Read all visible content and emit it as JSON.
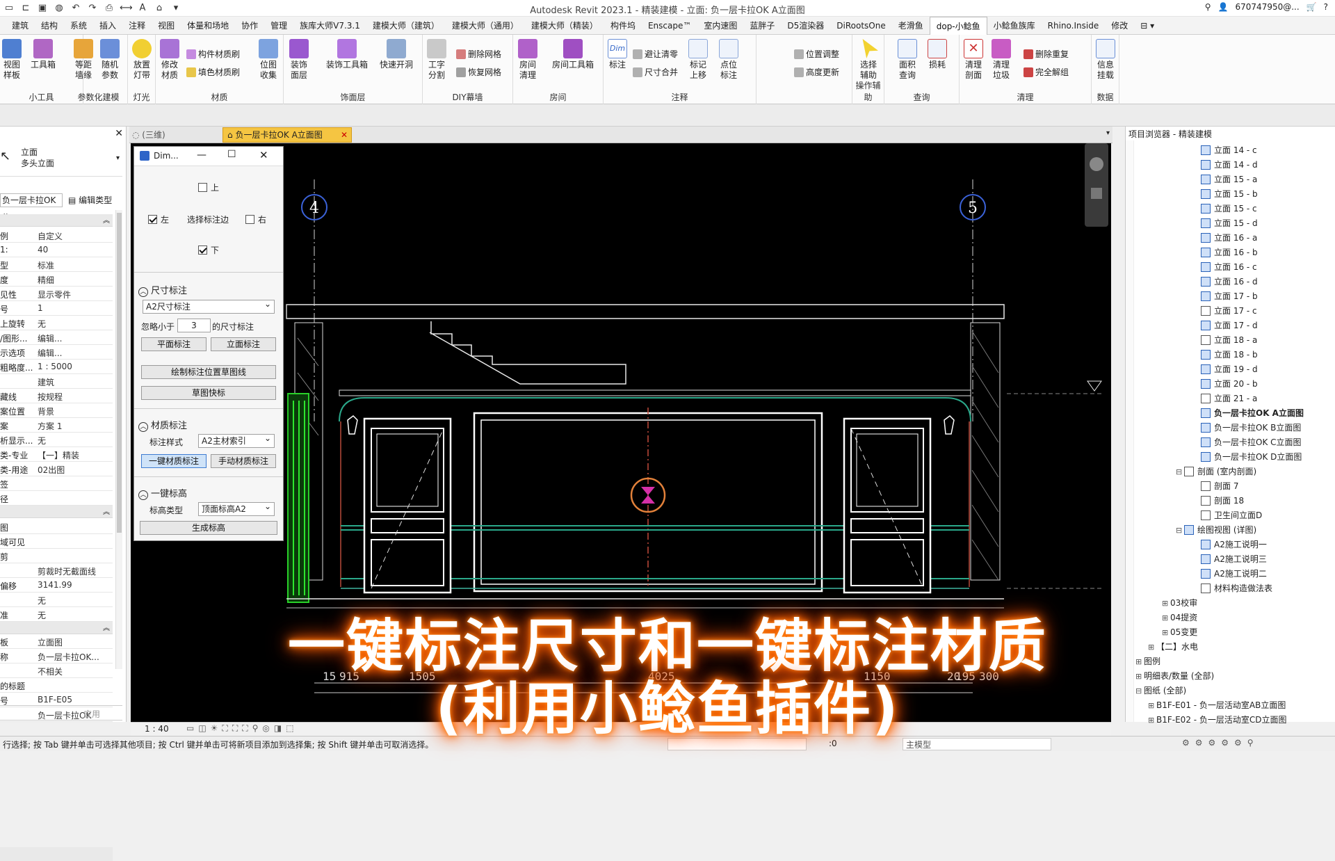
{
  "titlebar": {
    "title": "Autodesk Revit 2023.1 - 精装建模 - 立面: 负一层卡拉OK A立面图",
    "user": "670747950@...",
    "help": "?"
  },
  "menu": [
    "建筑",
    "结构",
    "系统",
    "插入",
    "注释",
    "视图",
    "体量和场地",
    "协作",
    "管理",
    "族库大师V7.3.1",
    "建模大师（建筑）",
    "建模大师（通用）",
    "建模大师（精装）",
    "构件坞",
    "Enscape™",
    "室内速图",
    "蓝胖子",
    "D5渲染器",
    "DiRootsOne",
    "老滑鱼",
    "dop-小鲶鱼",
    "小鲶鱼族库",
    "Rhino.Inside",
    "修改"
  ],
  "menu_active": "dop-小鲶鱼",
  "ribbon": {
    "groups": [
      {
        "label": "小工具",
        "buttons": [
          "视图\n样板",
          "工具箱"
        ]
      },
      {
        "label": "参数化建模",
        "buttons": [
          "等距\n墙缘",
          "随机\n参数"
        ]
      },
      {
        "label": "灯光",
        "buttons": [
          "放置\n灯带"
        ]
      },
      {
        "label": "材质",
        "buttons": [
          "修改\n材质",
          "位图\n收集"
        ],
        "small": [
          "构件材质刷",
          "填色材质刷"
        ]
      },
      {
        "label": "饰面层",
        "buttons": [
          "装饰\n面层",
          "装饰工具箱",
          "快速开洞"
        ]
      },
      {
        "label": "DIY幕墙",
        "buttons": [
          "工字\n分割"
        ],
        "small": [
          "删除网格",
          "恢复网格"
        ]
      },
      {
        "label": "房间",
        "buttons": [
          "房间\n清理",
          "房间工具箱"
        ]
      },
      {
        "label": "注释",
        "buttons": [
          "标注",
          "标记\n上移",
          "点位\n标注"
        ],
        "small": [
          "避让清零",
          "尺寸合并",
          "位置调整",
          "高度更新"
        ]
      },
      {
        "label": "操作辅助",
        "buttons": [
          "选择\n辅助"
        ]
      },
      {
        "label": "查询",
        "buttons": [
          "面积\n查询",
          "损耗"
        ]
      },
      {
        "label": "清理",
        "buttons": [
          "清理\n剖面",
          "清理\n垃圾"
        ],
        "small": [
          "删除重复",
          "完全解组"
        ]
      },
      {
        "label": "数据",
        "buttons": [
          "信息\n挂载"
        ]
      }
    ],
    "dim_text": "Dim"
  },
  "properties": {
    "type_main": "立面",
    "type_sub": "多头立面",
    "view_select": "负一层卡拉OK",
    "edit_type": "编辑类型",
    "rows": [
      {
        "k": "例",
        "v": "自定义"
      },
      {
        "k": "1:",
        "v": "40"
      },
      {
        "k": "型",
        "v": "标准"
      },
      {
        "k": "度",
        "v": "精细"
      },
      {
        "k": "见性",
        "v": "显示零件"
      },
      {
        "k": "号",
        "v": "1"
      },
      {
        "k": "上旋转",
        "v": "无"
      },
      {
        "k": "/图形...",
        "v": "编辑..."
      },
      {
        "k": "示选项",
        "v": "编辑..."
      },
      {
        "k": "粗略度...",
        "v": "1 : 5000"
      },
      {
        "k": "",
        "v": "建筑"
      },
      {
        "k": "藏线",
        "v": "按规程"
      },
      {
        "k": "案位置",
        "v": "背景"
      },
      {
        "k": "案",
        "v": "方案 1"
      },
      {
        "k": "析显示...",
        "v": "无"
      },
      {
        "k": "类-专业",
        "v": "【一】精装"
      },
      {
        "k": "类-用途",
        "v": "02出图"
      },
      {
        "k": "签",
        "v": ""
      },
      {
        "k": "径",
        "v": ""
      }
    ],
    "rows2": [
      {
        "k": "图",
        "v": ""
      },
      {
        "k": "域可见",
        "v": ""
      },
      {
        "k": "剪",
        "v": ""
      },
      {
        "k": "",
        "v": "剪裁时无截面线"
      },
      {
        "k": "偏移",
        "v": "3141.99"
      },
      {
        "k": "",
        "v": "无"
      },
      {
        "k": "准",
        "v": "无"
      }
    ],
    "rows3": [
      {
        "k": "板",
        "v": "立面图"
      },
      {
        "k": "称",
        "v": "负一层卡拉OK..."
      },
      {
        "k": "",
        "v": "不相关"
      },
      {
        "k": "的标题",
        "v": ""
      },
      {
        "k": "号",
        "v": "B1F-E05"
      },
      {
        "k": "",
        "v": "负一层卡拉OK"
      }
    ],
    "apply": "应用"
  },
  "tabs": [
    {
      "label": "(三维)"
    },
    {
      "label": "负一层卡拉OK A立面图",
      "active": true
    }
  ],
  "dim_dialog": {
    "title": "Dim...",
    "top": "上",
    "left": "左",
    "select_edge": "选择标注边",
    "right": "右",
    "bottom": "下",
    "sec_dim": "尺寸标注",
    "dim_style": "A2尺寸标注",
    "ignore_prefix": "忽略小于",
    "ignore_val": "3",
    "ignore_suffix": "的尺寸标注",
    "btn_plan": "平面标注",
    "btn_elev": "立面标注",
    "btn_draw": "绘制标注位置草图线",
    "btn_quick": "草图快标",
    "sec_mat": "材质标注",
    "mat_style_label": "标注样式",
    "mat_style": "A2主材索引",
    "btn_onekey": "一键材质标注",
    "btn_manual": "手动材质标注",
    "sec_level": "一键标高",
    "level_type_label": "标高类型",
    "level_type": "顶面标高A2",
    "btn_gen": "生成标高"
  },
  "canvas": {
    "grid4": "4",
    "grid5": "5",
    "dims": [
      "15",
      "915",
      "1505",
      "4025",
      "1150",
      "20",
      "195",
      "300"
    ]
  },
  "browser": {
    "header": "项目浏览器 - 精装建模",
    "items": [
      {
        "t": "立面 14 - c",
        "i": 1
      },
      {
        "t": "立面 14 - d",
        "i": 1
      },
      {
        "t": "立面 15 - a",
        "i": 1
      },
      {
        "t": "立面 15 - b",
        "i": 1
      },
      {
        "t": "立面 15 - c",
        "i": 1
      },
      {
        "t": "立面 15 - d",
        "i": 1
      },
      {
        "t": "立面 16 - a",
        "i": 1
      },
      {
        "t": "立面 16 - b",
        "i": 1
      },
      {
        "t": "立面 16 - c",
        "i": 1
      },
      {
        "t": "立面 16 - d",
        "i": 1
      },
      {
        "t": "立面 17 - b",
        "i": 1
      },
      {
        "t": "立面 17 - c",
        "i": 1
      },
      {
        "t": "立面 17 - d",
        "i": 1
      },
      {
        "t": "立面 18 - a",
        "i": 1
      },
      {
        "t": "立面 18 - b",
        "i": 1
      },
      {
        "t": "立面 19 - d",
        "i": 1
      },
      {
        "t": "立面 20 - b",
        "i": 1
      },
      {
        "t": "立面 21 - a",
        "i": 1
      },
      {
        "t": "负一层卡拉OK A立面图",
        "i": 1,
        "bold": true
      },
      {
        "t": "负一层卡拉OK B立面图",
        "i": 1
      },
      {
        "t": "负一层卡拉OK C立面图",
        "i": 1
      },
      {
        "t": "负一层卡拉OK D立面图",
        "i": 1
      },
      {
        "t": "剖面 (室内剖面)",
        "i": 0,
        "exp": "−"
      },
      {
        "t": "剖面 7",
        "i": 1
      },
      {
        "t": "剖面 18",
        "i": 1
      },
      {
        "t": "卫生间立面D",
        "i": 1
      },
      {
        "t": "绘图视图 (详图)",
        "i": 0,
        "exp": "−"
      },
      {
        "t": "A2施工说明一",
        "i": 1
      },
      {
        "t": "A2施工说明三",
        "i": 1
      },
      {
        "t": "A2施工说明二",
        "i": 1
      },
      {
        "t": "材料构造做法表",
        "i": 1
      },
      {
        "t": "03校审",
        "i": -1,
        "exp": "+"
      },
      {
        "t": "04提资",
        "i": -1,
        "exp": "+"
      },
      {
        "t": "05变更",
        "i": -1,
        "exp": "+"
      },
      {
        "t": "【二】水电",
        "i": -2,
        "exp": "+"
      },
      {
        "t": "图例",
        "i": -3,
        "exp": "+"
      },
      {
        "t": "明细表/数量 (全部)",
        "i": -3,
        "exp": "+"
      },
      {
        "t": "图纸 (全部)",
        "i": -3,
        "exp": "−"
      },
      {
        "t": "B1F-E01 - 负一层活动室AB立面图",
        "i": -2,
        "exp": "+"
      },
      {
        "t": "B1F-E02 - 负一层活动室CD立面图",
        "i": -2,
        "exp": "+"
      }
    ]
  },
  "viewctl": {
    "scale": "1 : 40"
  },
  "status": {
    "text": "行选择; 按 Tab 键并单击可选择其他项目; 按 Ctrl 键并单击可将新项目添加到选择集; 按 Shift 键并单击可取消选择。",
    "zero": ":0",
    "model": "主模型"
  },
  "caption": {
    "line1": "一键标注尺寸和一键标注材质",
    "line2": "(利用小鲶鱼插件)"
  }
}
